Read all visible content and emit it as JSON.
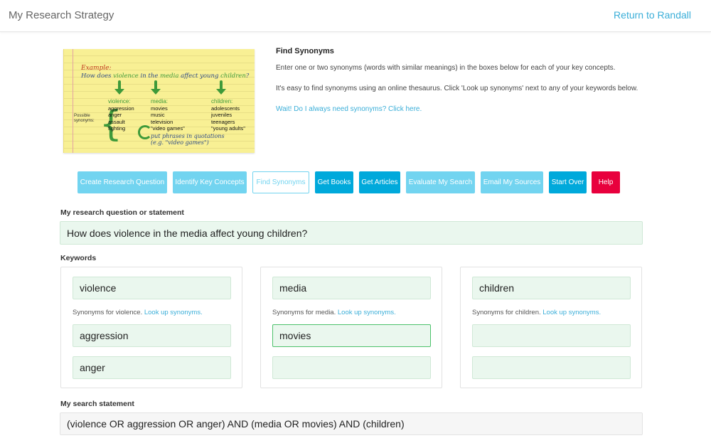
{
  "header": {
    "brand": "My Research Strategy",
    "return_link": "Return to Randall"
  },
  "example_note": {
    "heading": "Example:",
    "question_pre": "How does ",
    "question_w1": "violence",
    "question_mid1": " in the ",
    "question_w2": "media",
    "question_mid2": " affect young ",
    "question_w3": "children",
    "question_post": "?",
    "possible_label": "Possible synonyms:",
    "columns": [
      {
        "head": "violence:",
        "items": [
          "aggression",
          "anger",
          "assault",
          "fighting"
        ]
      },
      {
        "head": "media:",
        "items": [
          "movies",
          "music",
          "television",
          "\"video games\""
        ]
      },
      {
        "head": "children:",
        "items": [
          "adolescents",
          "juveniles",
          "teenagers",
          "\"young adults\""
        ]
      }
    ],
    "phrase_tip_1": "put phrases in quotations",
    "phrase_tip_2": "(e.g. \"video games\")"
  },
  "intro": {
    "title": "Find Synonyms",
    "p1": "Enter one or two synonyms (words with similar meanings) in the boxes below for each of your key concepts.",
    "p2": "It's easy to find synonyms using an online thesaurus. Click 'Look up synonyms' next to any of your keywords below.",
    "link": "Wait! Do I always need synonyms? Click here."
  },
  "steps": [
    {
      "label": "Create Research Question",
      "style": "light"
    },
    {
      "label": "Identify Key Concepts",
      "style": "light"
    },
    {
      "label": "Find Synonyms",
      "style": "outline"
    },
    {
      "label": "Get Books",
      "style": "dark"
    },
    {
      "label": "Get Articles",
      "style": "dark"
    },
    {
      "label": "Evaluate My Search",
      "style": "light"
    },
    {
      "label": "Email My Sources",
      "style": "light"
    },
    {
      "label": "Start Over",
      "style": "dark"
    },
    {
      "label": "Help",
      "style": "red"
    }
  ],
  "question": {
    "label": "My research question or statement",
    "value": "How does violence in the media affect young children?"
  },
  "keywords": {
    "label": "Keywords",
    "lookup_text": "Look up synonyms.",
    "panels": [
      {
        "keyword": "violence",
        "syn_prefix": "Synonyms for violence.",
        "synonyms": [
          "aggression",
          "anger"
        ]
      },
      {
        "keyword": "media",
        "syn_prefix": "Synonyms for media.",
        "synonyms": [
          "movies",
          ""
        ]
      },
      {
        "keyword": "children",
        "syn_prefix": "Synonyms for children.",
        "synonyms": [
          "",
          ""
        ]
      }
    ]
  },
  "search": {
    "label": "My search statement",
    "value": "(violence OR aggression OR anger) AND (media OR movies) AND (children)"
  },
  "colors": {
    "accent": "#3aaed8",
    "step_light": "#72d4f0",
    "step_dark": "#00a9db",
    "help_red": "#e8003d",
    "field_bg": "#eaf7ee"
  }
}
